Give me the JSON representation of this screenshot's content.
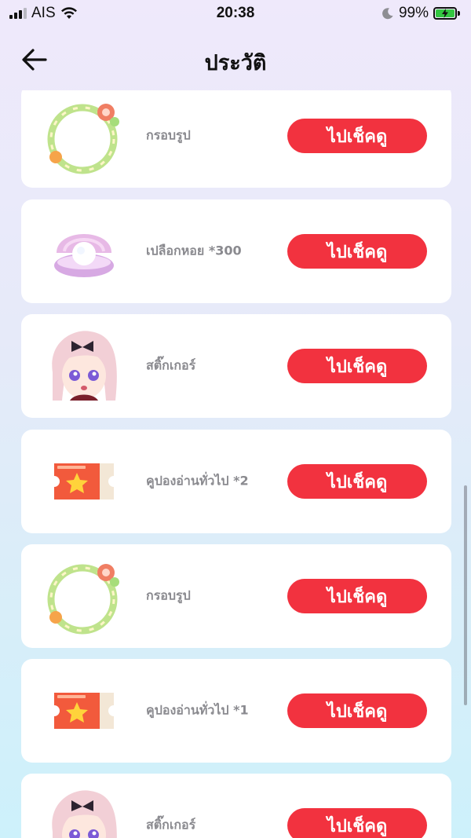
{
  "status_bar": {
    "carrier": "AIS",
    "time": "20:38",
    "battery": "99%"
  },
  "header": {
    "title": "ประวัติ"
  },
  "items": [
    {
      "icon": "frame-ring-icon",
      "name": "กรอบรูป",
      "button": "ไปเช็คดู"
    },
    {
      "icon": "pearl-shell-icon",
      "name": "เปลือกหอย *300",
      "button": "ไปเช็คดู"
    },
    {
      "icon": "anime-girl-sticker-icon",
      "name": "สติ๊กเกอร์",
      "button": "ไปเช็คดู"
    },
    {
      "icon": "coupon-ticket-icon",
      "name": "คูปองอ่านทั่วไป *2",
      "button": "ไปเช็คดู"
    },
    {
      "icon": "frame-ring-icon",
      "name": "กรอบรูป",
      "button": "ไปเช็คดู"
    },
    {
      "icon": "coupon-ticket-icon",
      "name": "คูปองอ่านทั่วไป *1",
      "button": "ไปเช็คดู"
    },
    {
      "icon": "anime-girl-sticker-icon",
      "name": "สติ๊กเกอร์",
      "button": "ไปเช็คดู"
    }
  ],
  "colors": {
    "button_red": "#f2323f",
    "card": "#ffffff",
    "item_text": "#8a8a8f"
  }
}
